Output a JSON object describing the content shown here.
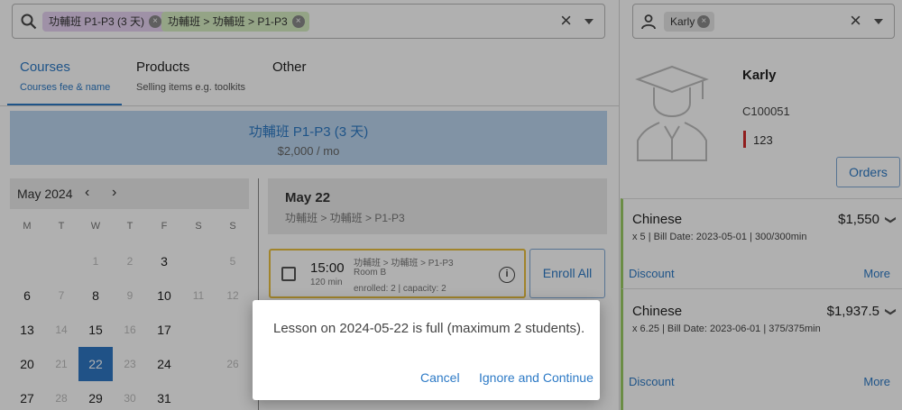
{
  "search": {
    "chips": [
      "功輔班 P1-P3 (3 天)",
      "功輔班 > 功輔班 > P1-P3"
    ],
    "chip_remove_glyph": "×",
    "clear_glyph": "×"
  },
  "tabs": [
    {
      "label": "Courses",
      "sub": "Courses fee & name"
    },
    {
      "label": "Products",
      "sub": "Selling items e.g. toolkits"
    },
    {
      "label": "Other",
      "sub": ""
    }
  ],
  "course": {
    "title": "功輔班 P1-P3 (3 天)",
    "price": "$2,000 / mo"
  },
  "calendar": {
    "month": "May 2024",
    "prev_glyph": "‹",
    "next_glyph": "›",
    "weekdays": [
      "M",
      "T",
      "W",
      "T",
      "F",
      "S",
      "S"
    ],
    "days": [
      {
        "label": "1",
        "muted": true
      },
      {
        "label": "2",
        "muted": true
      },
      {
        "label": "3",
        "muted": false
      },
      {
        "label": "5",
        "muted": true
      },
      {
        "label": "6",
        "muted": false
      },
      {
        "label": "7",
        "muted": true
      },
      {
        "label": "8",
        "muted": false
      },
      {
        "label": "9",
        "muted": true
      },
      {
        "label": "10",
        "muted": false
      },
      {
        "label": "11",
        "muted": true
      },
      {
        "label": "12",
        "muted": true
      },
      {
        "label": "13",
        "muted": false
      },
      {
        "label": "14",
        "muted": true
      },
      {
        "label": "15",
        "muted": false
      },
      {
        "label": "16",
        "muted": true
      },
      {
        "label": "17",
        "muted": false
      },
      {
        "label": "20",
        "muted": false
      },
      {
        "label": "21",
        "muted": true
      },
      {
        "label": "22",
        "muted": false,
        "selected": true
      },
      {
        "label": "23",
        "muted": true
      },
      {
        "label": "24",
        "muted": false
      },
      {
        "label": "26",
        "muted": true
      },
      {
        "label": "27",
        "muted": false
      },
      {
        "label": "28",
        "muted": true
      },
      {
        "label": "29",
        "muted": false
      },
      {
        "label": "30",
        "muted": true
      },
      {
        "label": "31",
        "muted": false
      }
    ]
  },
  "date_panel": {
    "title": "May 22",
    "sub": "功輔班 > 功輔班 > P1-P3"
  },
  "lesson": {
    "time": "15:00",
    "duration": "120 min",
    "path": "功輔班 > 功輔班 > P1-P3",
    "room": "Room B",
    "stats": "enrolled: 2 | capacity: 2",
    "info_glyph": "i"
  },
  "enroll_all_label": "Enroll All",
  "user": {
    "chip": "Karly",
    "chip_remove_glyph": "×",
    "clear_glyph": "×"
  },
  "student": {
    "name": "Karly",
    "id": "C100051",
    "flag": "123"
  },
  "orders_label": "Orders",
  "orders": [
    {
      "name": "Chinese",
      "price": "$1,550",
      "detail": "x 5 | Bill Date: 2023-05-01 | 300/300min",
      "discount": "Discount",
      "more": "More",
      "chevron": "❯"
    },
    {
      "name": "Chinese",
      "price": "$1,937.5",
      "detail": "x 6.25 | Bill Date: 2023-06-01 | 375/375min",
      "discount": "Discount",
      "more": "More",
      "chevron": "❯"
    }
  ],
  "dialog": {
    "message": "Lesson on 2024-05-22 is full (maximum 2 students).",
    "cancel": "Cancel",
    "ignore": "Ignore and Continue"
  },
  "colors": {
    "accent": "#2d7ac6",
    "warning_border": "#e9bf3f",
    "selected_day": "#2f78c4",
    "flag": "#d12a2a"
  }
}
